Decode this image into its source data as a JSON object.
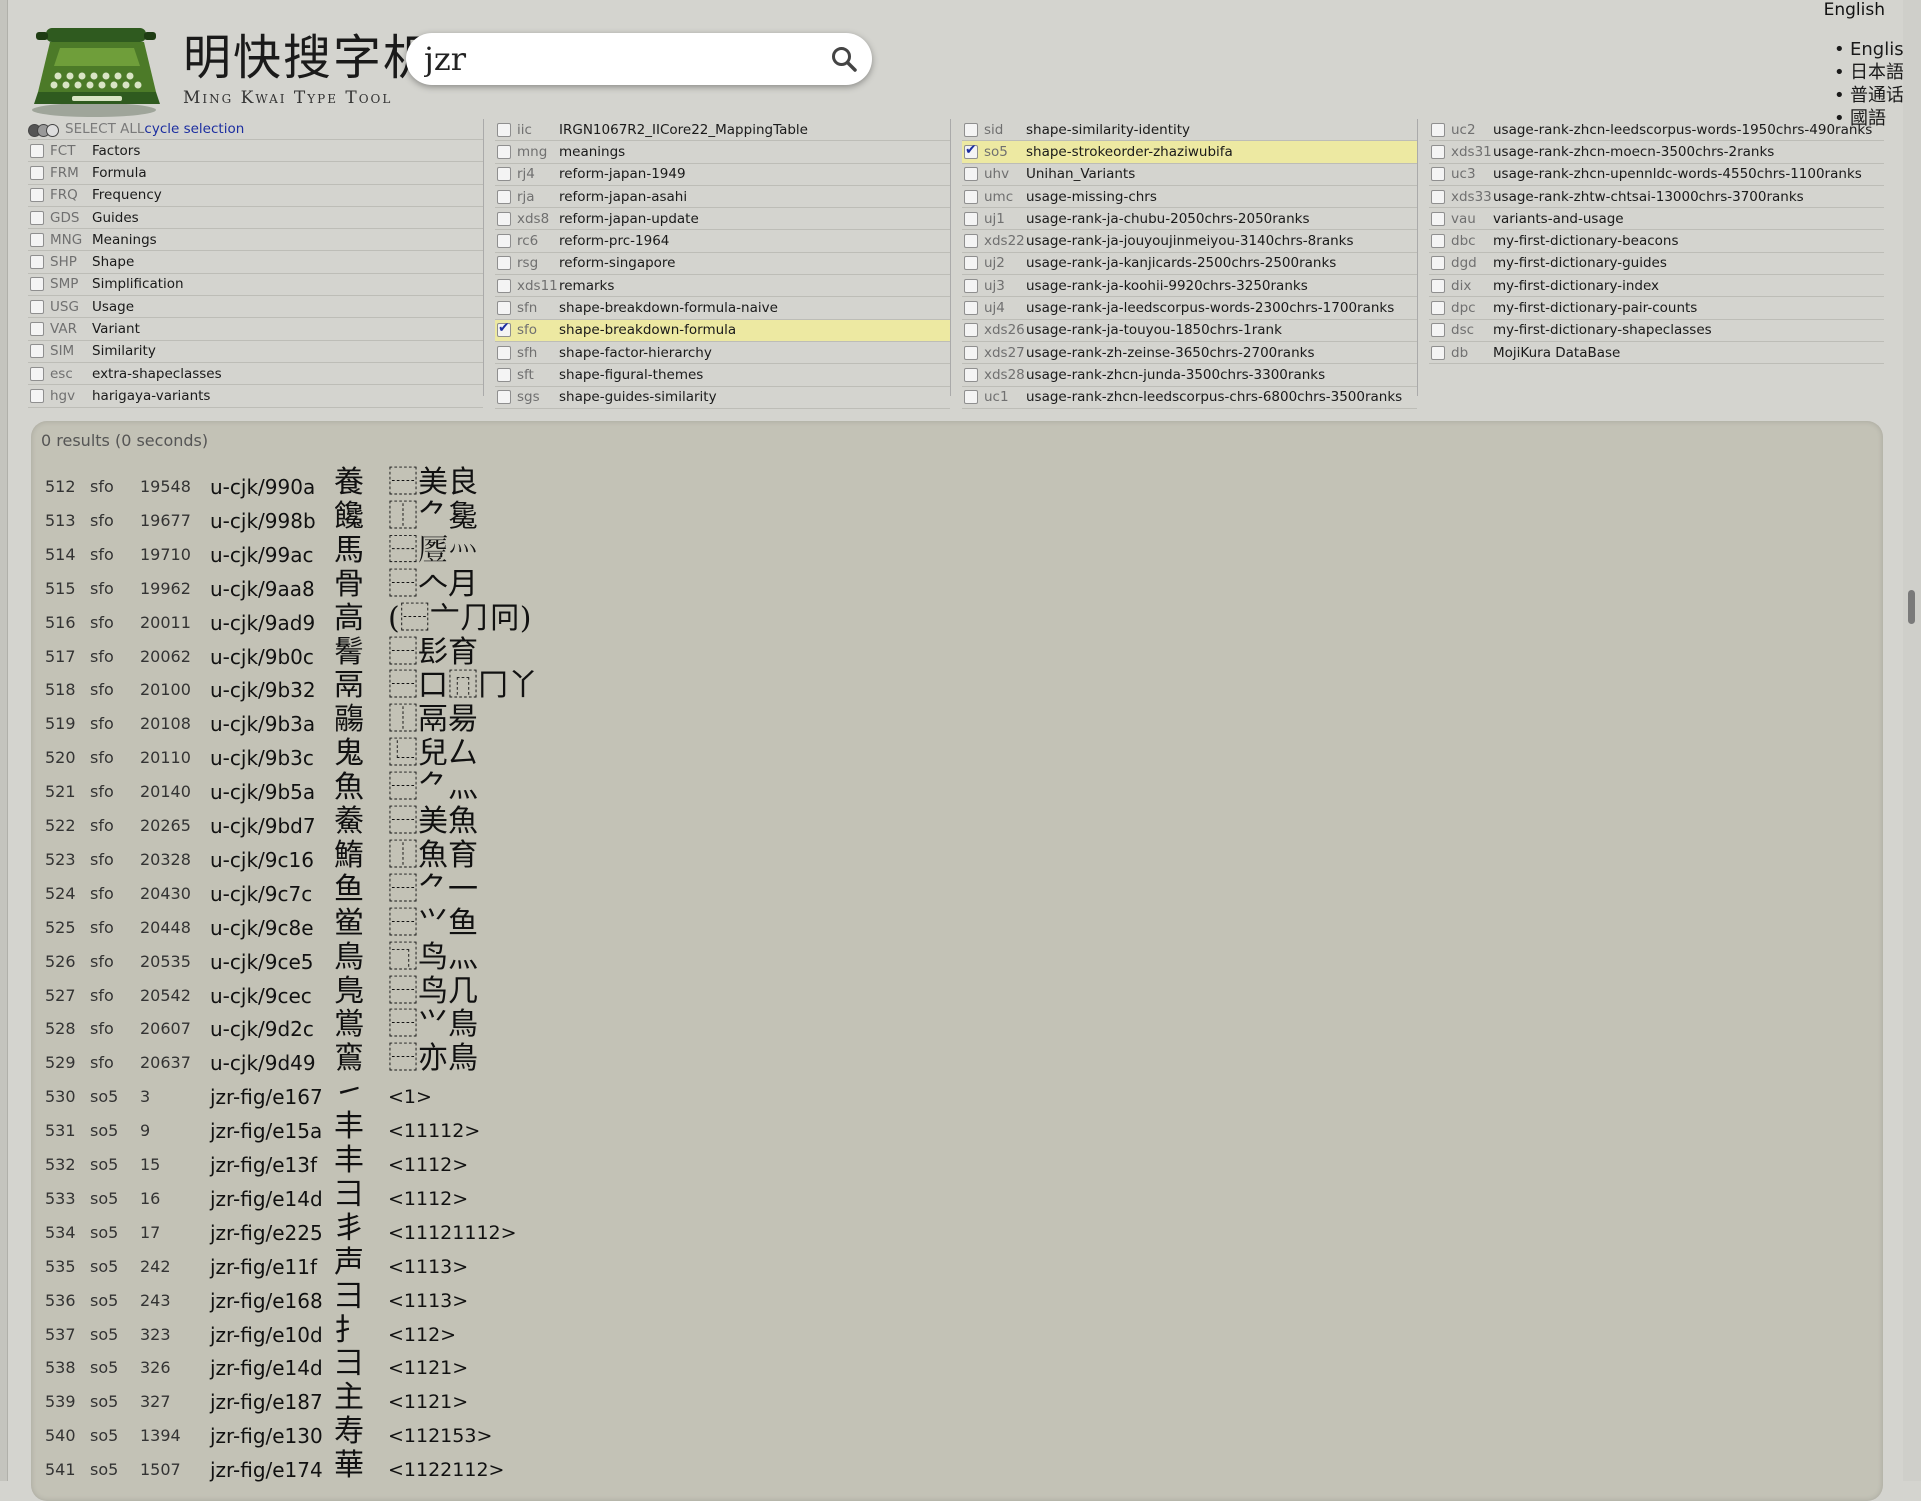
{
  "brand": {
    "cjk": "明快搜字机",
    "latin": "Ming Kwai Type Tool"
  },
  "search": {
    "value": "jzr"
  },
  "lang": {
    "current": "English",
    "options": [
      "English",
      "日本語",
      "普通话",
      "國語"
    ]
  },
  "selection": {
    "select_all": "SELECT ALL",
    "cycle": "cycle selection"
  },
  "columns": [
    [
      {
        "code": "FCT",
        "name": "Factors",
        "checked": false
      },
      {
        "code": "FRM",
        "name": "Formula",
        "checked": false
      },
      {
        "code": "FRQ",
        "name": "Frequency",
        "checked": false
      },
      {
        "code": "GDS",
        "name": "Guides",
        "checked": false
      },
      {
        "code": "MNG",
        "name": "Meanings",
        "checked": false
      },
      {
        "code": "SHP",
        "name": "Shape",
        "checked": false
      },
      {
        "code": "SMP",
        "name": "Simplification",
        "checked": false
      },
      {
        "code": "USG",
        "name": "Usage",
        "checked": false
      },
      {
        "code": "VAR",
        "name": "Variant",
        "checked": false
      },
      {
        "code": "SIM",
        "name": "Similarity",
        "checked": false
      },
      {
        "code": "esc",
        "name": "extra-shapeclasses",
        "checked": false
      },
      {
        "code": "hgv",
        "name": "harigaya-variants",
        "checked": false
      }
    ],
    [
      {
        "code": "iic",
        "name": "IRGN1067R2_IICore22_MappingTable",
        "checked": false
      },
      {
        "code": "mng",
        "name": "meanings",
        "checked": false
      },
      {
        "code": "rj4",
        "name": "reform-japan-1949",
        "checked": false
      },
      {
        "code": "rja",
        "name": "reform-japan-asahi",
        "checked": false
      },
      {
        "code": "xds8",
        "name": "reform-japan-update",
        "checked": false
      },
      {
        "code": "rc6",
        "name": "reform-prc-1964",
        "checked": false
      },
      {
        "code": "rsg",
        "name": "reform-singapore",
        "checked": false
      },
      {
        "code": "xds11",
        "name": "remarks",
        "checked": false
      },
      {
        "code": "sfn",
        "name": "shape-breakdown-formula-naive",
        "checked": false
      },
      {
        "code": "sfo",
        "name": "shape-breakdown-formula",
        "checked": true
      },
      {
        "code": "sfh",
        "name": "shape-factor-hierarchy",
        "checked": false
      },
      {
        "code": "sft",
        "name": "shape-figural-themes",
        "checked": false
      },
      {
        "code": "sgs",
        "name": "shape-guides-similarity",
        "checked": false
      }
    ],
    [
      {
        "code": "sid",
        "name": "shape-similarity-identity",
        "checked": false
      },
      {
        "code": "so5",
        "name": "shape-strokeorder-zhaziwubifa",
        "checked": true
      },
      {
        "code": "uhv",
        "name": "Unihan_Variants",
        "checked": false
      },
      {
        "code": "umc",
        "name": "usage-missing-chrs",
        "checked": false
      },
      {
        "code": "uj1",
        "name": "usage-rank-ja-chubu-2050chrs-2050ranks",
        "checked": false
      },
      {
        "code": "xds22",
        "name": "usage-rank-ja-jouyoujinmeiyou-3140chrs-8ranks",
        "checked": false
      },
      {
        "code": "uj2",
        "name": "usage-rank-ja-kanjicards-2500chrs-2500ranks",
        "checked": false
      },
      {
        "code": "uj3",
        "name": "usage-rank-ja-koohii-9920chrs-3250ranks",
        "checked": false
      },
      {
        "code": "uj4",
        "name": "usage-rank-ja-leedscorpus-words-2300chrs-1700ranks",
        "checked": false
      },
      {
        "code": "xds26",
        "name": "usage-rank-ja-touyou-1850chrs-1rank",
        "checked": false
      },
      {
        "code": "xds27",
        "name": "usage-rank-zh-zeinse-3650chrs-2700ranks",
        "checked": false
      },
      {
        "code": "xds28",
        "name": "usage-rank-zhcn-junda-3500chrs-3300ranks",
        "checked": false
      },
      {
        "code": "uc1",
        "name": "usage-rank-zhcn-leedscorpus-chrs-6800chrs-3500ranks",
        "checked": false
      }
    ],
    [
      {
        "code": "uc2",
        "name": "usage-rank-zhcn-leedscorpus-words-1950chrs-490ranks",
        "checked": false
      },
      {
        "code": "xds31",
        "name": "usage-rank-zhcn-moecn-3500chrs-2ranks",
        "checked": false
      },
      {
        "code": "uc3",
        "name": "usage-rank-zhcn-upennldc-words-4550chrs-1100ranks",
        "checked": false
      },
      {
        "code": "xds33",
        "name": "usage-rank-zhtw-chtsai-13000chrs-3700ranks",
        "checked": false
      },
      {
        "code": "vau",
        "name": "variants-and-usage",
        "checked": false
      },
      {
        "code": "dbc",
        "name": "my-first-dictionary-beacons",
        "checked": false
      },
      {
        "code": "dgd",
        "name": "my-first-dictionary-guides",
        "checked": false
      },
      {
        "code": "dix",
        "name": "my-first-dictionary-index",
        "checked": false
      },
      {
        "code": "dpc",
        "name": "my-first-dictionary-pair-counts",
        "checked": false
      },
      {
        "code": "dsc",
        "name": "my-first-dictionary-shapeclasses",
        "checked": false
      },
      {
        "code": "db",
        "name": "MojiKura DataBase",
        "checked": false
      }
    ]
  ],
  "results": {
    "count_text": "0 results (0 seconds)",
    "rows": [
      {
        "idx": "512",
        "src": "sfo",
        "num": "19548",
        "id": "u-cjk/990a",
        "glyph": "養",
        "formula": "⿱美良"
      },
      {
        "idx": "513",
        "src": "sfo",
        "num": "19677",
        "id": "u-cjk/998b",
        "glyph": "饞",
        "formula": "⿰⺈毚"
      },
      {
        "idx": "514",
        "src": "sfo",
        "num": "19710",
        "id": "u-cjk/99ac",
        "glyph": "馬",
        "formula": "⿱𠪶灬"
      },
      {
        "idx": "515",
        "src": "sfo",
        "num": "19962",
        "id": "u-cjk/9aa8",
        "glyph": "骨",
        "formula": "⿱𠆢月"
      },
      {
        "idx": "516",
        "src": "sfo",
        "num": "20011",
        "id": "u-cjk/9ad9",
        "glyph": "高",
        "formula": "(⿱亠⺆冋)"
      },
      {
        "idx": "517",
        "src": "sfo",
        "num": "20062",
        "id": "u-cjk/9b0c",
        "glyph": "鬌",
        "formula": "⿱髟育"
      },
      {
        "idx": "518",
        "src": "sfo",
        "num": "20100",
        "id": "u-cjk/9b32",
        "glyph": "鬲",
        "formula": "⿱口⿵冂丫"
      },
      {
        "idx": "519",
        "src": "sfo",
        "num": "20108",
        "id": "u-cjk/9b3a",
        "glyph": "鬺",
        "formula": "⿰鬲昜"
      },
      {
        "idx": "520",
        "src": "sfo",
        "num": "20110",
        "id": "u-cjk/9b3c",
        "glyph": "鬼",
        "formula": "⿺兒厶"
      },
      {
        "idx": "521",
        "src": "sfo",
        "num": "20140",
        "id": "u-cjk/9b5a",
        "glyph": "魚",
        "formula": "⿱⺈灬"
      },
      {
        "idx": "522",
        "src": "sfo",
        "num": "20265",
        "id": "u-cjk/9bd7",
        "glyph": "鯗",
        "formula": "⿱美魚"
      },
      {
        "idx": "523",
        "src": "sfo",
        "num": "20328",
        "id": "u-cjk/9c16",
        "glyph": "鰖",
        "formula": "⿰魚育"
      },
      {
        "idx": "524",
        "src": "sfo",
        "num": "20430",
        "id": "u-cjk/9c7c",
        "glyph": "鱼",
        "formula": "⿱⺈一"
      },
      {
        "idx": "525",
        "src": "sfo",
        "num": "20448",
        "id": "u-cjk/9c8e",
        "glyph": "鲎",
        "formula": "⿱⺍鱼"
      },
      {
        "idx": "526",
        "src": "sfo",
        "num": "20535",
        "id": "u-cjk/9ce5",
        "glyph": "鳥",
        "formula": "⿹鸟灬"
      },
      {
        "idx": "527",
        "src": "sfo",
        "num": "20542",
        "id": "u-cjk/9cec",
        "glyph": "鳬",
        "formula": "⿱鸟几"
      },
      {
        "idx": "528",
        "src": "sfo",
        "num": "20607",
        "id": "u-cjk/9d2c",
        "glyph": "鴬",
        "formula": "⿱⺍鳥"
      },
      {
        "idx": "529",
        "src": "sfo",
        "num": "20637",
        "id": "u-cjk/9d49",
        "glyph": "鵉",
        "formula": "⿱亦鳥"
      },
      {
        "idx": "530",
        "src": "so5",
        "num": "3",
        "id": "jzr-fig/e167",
        "glyph": "㇀",
        "formula": "<1>"
      },
      {
        "idx": "531",
        "src": "so5",
        "num": "9",
        "id": "jzr-fig/e15a",
        "glyph": "丰",
        "formula": "<11112>"
      },
      {
        "idx": "532",
        "src": "so5",
        "num": "15",
        "id": "jzr-fig/e13f",
        "glyph": "丰",
        "formula": "<1112>"
      },
      {
        "idx": "533",
        "src": "so5",
        "num": "16",
        "id": "jzr-fig/e14d",
        "glyph": "彐",
        "formula": "<1112>"
      },
      {
        "idx": "534",
        "src": "so5",
        "num": "17",
        "id": "jzr-fig/e225",
        "glyph": "丯",
        "formula": "<11121112>"
      },
      {
        "idx": "535",
        "src": "so5",
        "num": "242",
        "id": "jzr-fig/e11f",
        "glyph": "声",
        "formula": "<1113>"
      },
      {
        "idx": "536",
        "src": "so5",
        "num": "243",
        "id": "jzr-fig/e168",
        "glyph": "彐",
        "formula": "<1113>"
      },
      {
        "idx": "537",
        "src": "so5",
        "num": "323",
        "id": "jzr-fig/e10d",
        "glyph": "扌",
        "formula": "<112>"
      },
      {
        "idx": "538",
        "src": "so5",
        "num": "326",
        "id": "jzr-fig/e14d",
        "glyph": "彐",
        "formula": "<1121>"
      },
      {
        "idx": "539",
        "src": "so5",
        "num": "327",
        "id": "jzr-fig/e187",
        "glyph": "主",
        "formula": "<1121>"
      },
      {
        "idx": "540",
        "src": "so5",
        "num": "1394",
        "id": "jzr-fig/e130",
        "glyph": "寿",
        "formula": "<112153>"
      },
      {
        "idx": "541",
        "src": "so5",
        "num": "1507",
        "id": "jzr-fig/e174",
        "glyph": "華",
        "formula": "<1122112>"
      }
    ]
  },
  "colors": {
    "background": "#d4d4cf",
    "panel": "#c3c2b6",
    "highlight": "#ede9a2",
    "link": "#1c2ea0"
  }
}
